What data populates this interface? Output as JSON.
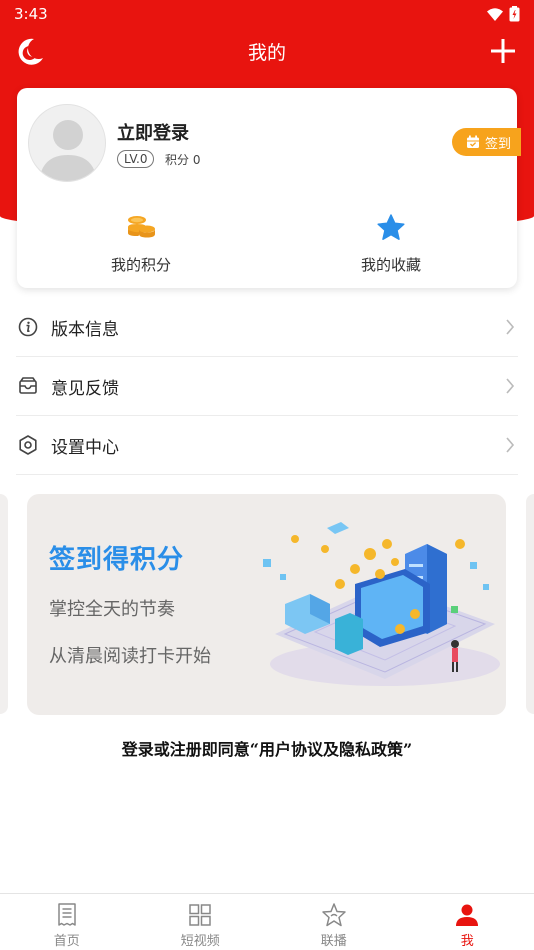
{
  "status_bar": {
    "time": "3:43"
  },
  "header": {
    "title": "我的"
  },
  "profile": {
    "login_text": "立即登录",
    "level": "LV.0",
    "points": "积分 0",
    "signin_label": "签到",
    "quick_links": [
      {
        "label": "我的积分",
        "icon": "coins-icon"
      },
      {
        "label": "我的收藏",
        "icon": "star-icon"
      }
    ]
  },
  "menu": [
    {
      "label": "版本信息",
      "icon": "info-icon"
    },
    {
      "label": "意见反馈",
      "icon": "feedback-inbox-icon"
    },
    {
      "label": "设置中心",
      "icon": "settings-gear-icon"
    }
  ],
  "banner": {
    "title": "签到得积分",
    "line1": "掌控全天的节奏",
    "line2": "从清晨阅读打卡开始"
  },
  "agreement_text": "登录或注册即同意“用户协议及隐私政策”",
  "tabbar": [
    {
      "label": "首页",
      "icon": "news-icon",
      "active": false
    },
    {
      "label": "短视频",
      "icon": "grid-icon",
      "active": false
    },
    {
      "label": "联播",
      "icon": "star-outline-icon",
      "active": false
    },
    {
      "label": "我",
      "icon": "person-icon",
      "active": true
    }
  ],
  "colors": {
    "primary_red": "#e8140f",
    "signin_orange": "#f7a31c",
    "banner_blue": "#2a8ee8",
    "coin_gold": "#f5a623",
    "star_blue": "#2a8ee8"
  }
}
